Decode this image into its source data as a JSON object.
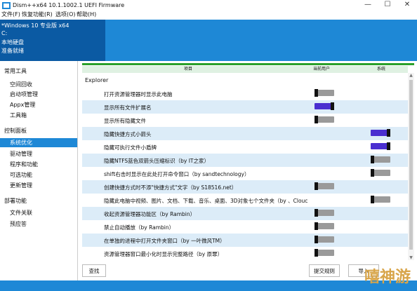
{
  "window": {
    "title": "Dism++x64 10.1.1002.1 UEFI Firmware",
    "minimize": "—",
    "maximize": "☐",
    "close": "✕"
  },
  "menu": [
    "文件(F)",
    "恢复功能(R)",
    "选项(O)",
    "帮助(H)"
  ],
  "header": {
    "lines": [
      "*Windows 10 专业版 x64",
      "C:",
      "本地硬盘",
      "准备就绪"
    ]
  },
  "sidebar": {
    "items": [
      {
        "label": "常用工具",
        "type": "group"
      },
      {
        "label": "空间回收",
        "type": "item"
      },
      {
        "label": "启动项管理",
        "type": "item"
      },
      {
        "label": "Appx管理",
        "type": "item"
      },
      {
        "label": "工具箱",
        "type": "item"
      },
      {
        "label": "控制面板",
        "type": "group"
      },
      {
        "label": "系统优化",
        "type": "item",
        "selected": true
      },
      {
        "label": "驱动管理",
        "type": "item"
      },
      {
        "label": "程序和功能",
        "type": "item"
      },
      {
        "label": "可选功能",
        "type": "item"
      },
      {
        "label": "更新管理",
        "type": "item"
      },
      {
        "label": "部署功能",
        "type": "group"
      },
      {
        "label": "文件关联",
        "type": "item"
      },
      {
        "label": "预应答",
        "type": "item"
      }
    ]
  },
  "table": {
    "columns": {
      "item": "项目",
      "current_user": "当前用户",
      "system": "系统"
    },
    "group": "Explorer",
    "rows": [
      {
        "label": "打开资源管理器时显示此电脑",
        "user": "off",
        "system": null
      },
      {
        "label": "显示所有文件扩展名",
        "user": "on",
        "system": null
      },
      {
        "label": "显示所有隐藏文件",
        "user": "off",
        "system": null
      },
      {
        "label": "隐藏快捷方式小箭头",
        "user": null,
        "system": "on"
      },
      {
        "label": "隐藏可执行文件小盾牌",
        "user": null,
        "system": "on"
      },
      {
        "label": "隐藏NTFS蓝色双箭头压缩标识（by IT之家）",
        "user": null,
        "system": "off"
      },
      {
        "label": "shift右击时显示在此处打开命令窗口（by sandtechnology）",
        "user": null,
        "system": "off"
      },
      {
        "label": "创建快捷方式时不添\"快捷方式\"文字（by S18516.net）",
        "user": "off",
        "system": null
      },
      {
        "label": "隐藏此电脑中视频、图片、文档、下载、音乐、桌面、3D对象七个文件夹（by 、Clouc",
        "user": null,
        "system": "off"
      },
      {
        "label": "收起资源管理器功能区（by Rambin）",
        "user": "off",
        "system": null
      },
      {
        "label": "禁止自动播放（by Rambin）",
        "user": "off",
        "system": null
      },
      {
        "label": "在单独的进程中打开文件夹窗口（by 一叶微风TM）",
        "user": "off",
        "system": null
      },
      {
        "label": "资源管理器窗口最小化时显示完整路径（by 原罪）",
        "user": "off",
        "system": null
      }
    ]
  },
  "buttons": {
    "search": "查找",
    "submit_rule": "提交规则",
    "import": "导入"
  },
  "watermark": "嘻神游",
  "colors": {
    "accent": "#1e88d6",
    "toggle_on": "#4a2fd0",
    "green": "#2aa02a"
  }
}
